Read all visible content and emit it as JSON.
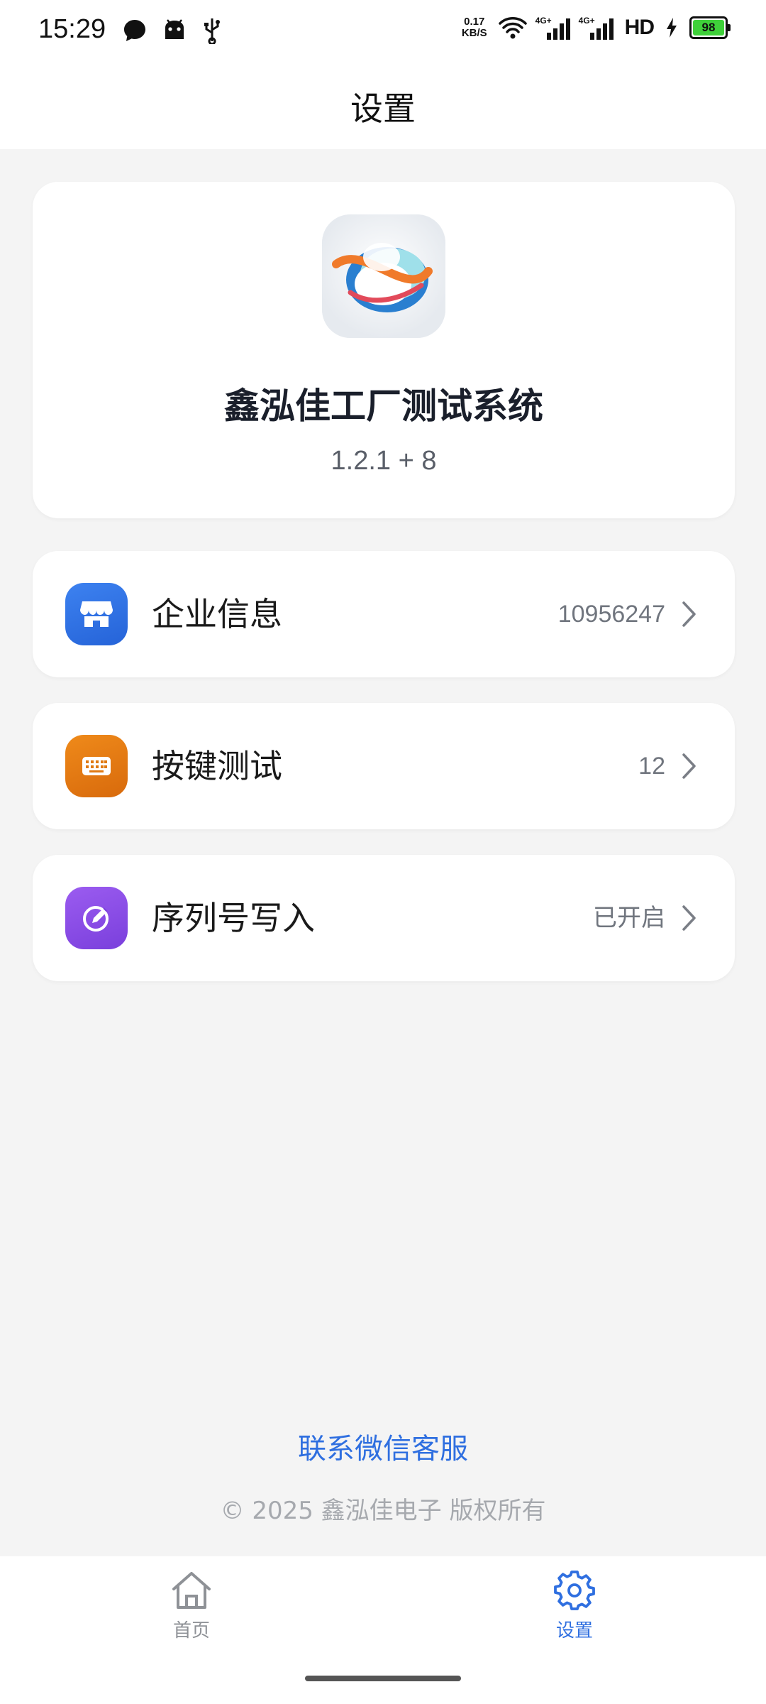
{
  "status_bar": {
    "time": "15:29",
    "net_speed_value": "0.17",
    "net_speed_unit": "KB/S",
    "sim1_label": "4G+",
    "sim2_label": "4G+",
    "hd_label": "HD",
    "battery_level": "98",
    "colors": {
      "battery_fill": "#3fd13a"
    }
  },
  "header": {
    "title": "设置"
  },
  "app_info": {
    "name": "鑫泓佳工厂测试系统",
    "version": "1.2.1 + 8"
  },
  "menu_items": [
    {
      "label": "企业信息",
      "value": "10956247",
      "icon": "store-icon",
      "color": "#2f6fe0"
    },
    {
      "label": "按键测试",
      "value": "12",
      "icon": "keyboard-icon",
      "color": "#e07a12"
    },
    {
      "label": "序列号写入",
      "value": "已开启",
      "icon": "edit-pen-icon",
      "color": "#8a4ee6"
    }
  ],
  "footer": {
    "contact_link": "联系微信客服",
    "copyright": "© 2025 鑫泓佳电子 版权所有"
  },
  "tabs": [
    {
      "label": "首页",
      "icon": "home-icon",
      "active": false
    },
    {
      "label": "设置",
      "icon": "gear-icon",
      "active": true
    }
  ],
  "colors": {
    "accent": "#2f6fe0",
    "inactive_tab": "#8e9196"
  }
}
